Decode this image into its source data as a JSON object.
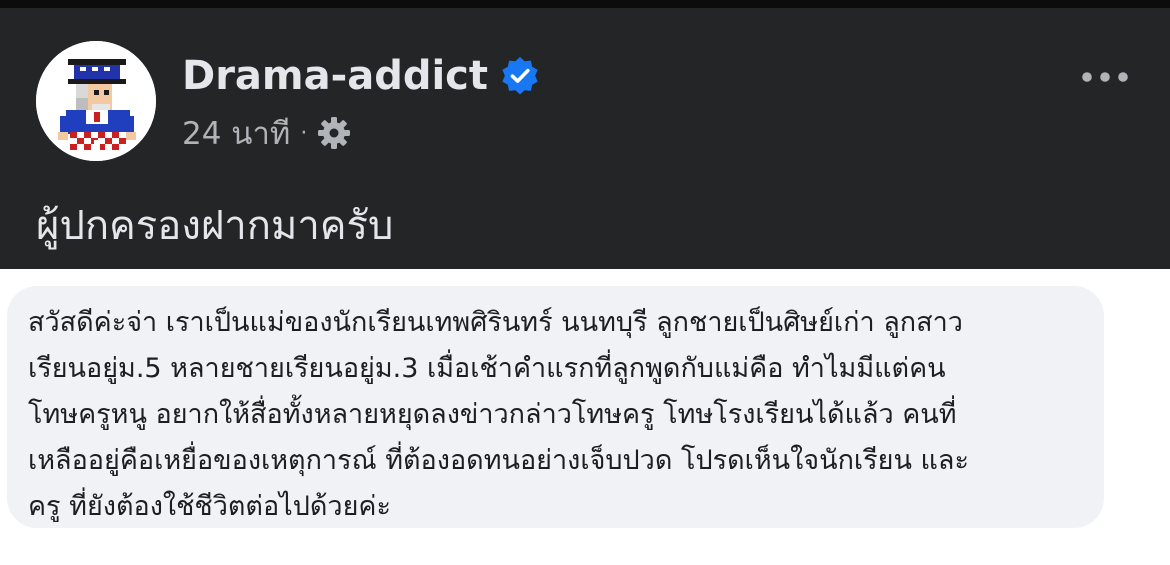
{
  "post": {
    "author": "Drama-addict",
    "verified_icon": "verified-badge-icon",
    "timestamp": "24 นาที",
    "separator": "·",
    "audience_icon": "gear-icon",
    "more_icon": "more-horizontal-icon",
    "text": "ผู้ปกครองฝากมาครับ"
  },
  "comment": {
    "lines": [
      "สวัสดีค่ะจ่า เราเป็นแม่ของนักเรียนเทพศิรินทร์ นนทบุรี ลูกชายเป็นศิษย์เก่า ลูกสาว",
      "เรียนอยู่ม.5 หลายชายเรียนอยู่ม.3 เมื่อเช้าคำแรกที่ลูกพูดกับแม่คือ ทำไมมีแต่คน",
      "โทษครูหนู   อยากให้สื่อทั้งหลายหยุดลงข่าวกล่าวโทษครู โทษโรงเรียนได้แล้ว คนที่",
      "เหลืออยู่คือเหยื่อของเหตุการณ์ ที่ต้องอดทนอย่างเจ็บปวด โปรดเห็นใจนักเรียน และ",
      "ครู ที่ยังต้องใช้ชีวิตต่อไปด้วยค่ะ"
    ]
  },
  "colors": {
    "header_bg": "#242526",
    "name_text": "#e4e6eb",
    "meta_text": "#b0b3b8",
    "verified_blue": "#1877f2",
    "bubble_bg": "#f0f2f5",
    "comment_text": "#1c1e21"
  }
}
